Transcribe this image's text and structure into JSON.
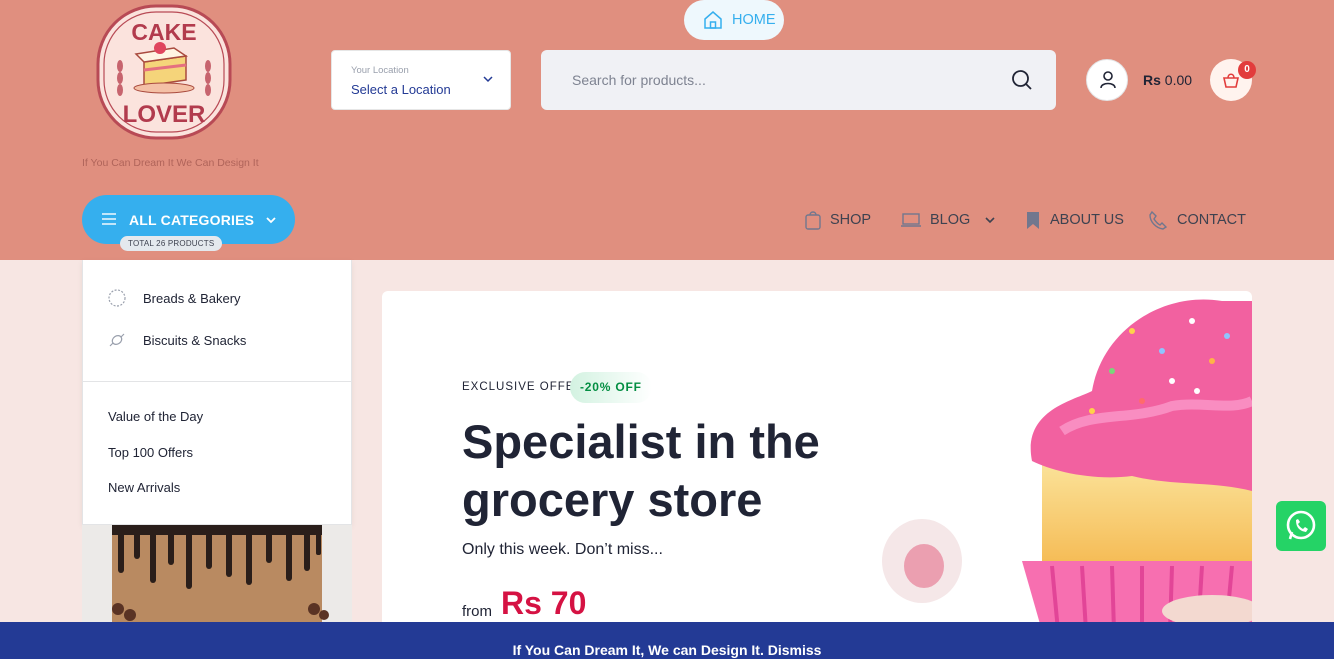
{
  "header": {
    "logo_text": [
      "CAKE",
      "LOVER"
    ],
    "tagline": "If You Can Dream It We Can Design It",
    "location": {
      "small_label": "Your Location",
      "value": "Select a Location"
    },
    "search": {
      "placeholder": "Search for products..."
    },
    "cart": {
      "currency": "Rs",
      "amount": "0.00",
      "count": "0"
    }
  },
  "categories_button": {
    "label": "ALL CATEGORIES",
    "count": "TOTAL 26 PRODUCTS"
  },
  "nav": {
    "items": [
      {
        "label": "HOME",
        "icon": "home-icon",
        "active": true
      },
      {
        "label": "SHOP",
        "icon": "shop-icon"
      },
      {
        "label": "BLOG",
        "icon": "laptop-icon",
        "has_dropdown": true
      },
      {
        "label": "ABOUT US",
        "icon": "bookmark-icon"
      },
      {
        "label": "CONTACT",
        "icon": "phone-icon"
      }
    ]
  },
  "dropdown": {
    "categories": [
      {
        "label": "Breads & Bakery",
        "icon": "bread-icon"
      },
      {
        "label": "Biscuits & Snacks",
        "icon": "candy-icon"
      }
    ],
    "links": [
      "Value of the Day",
      "Top 100 Offers",
      "New Arrivals"
    ]
  },
  "hero": {
    "offer_label": "EXCLUSIVE OFFER",
    "discount": "-20% OFF",
    "title": "Specialist in the grocery store",
    "subtitle": "Only this week. Don’t miss...",
    "from_label": "from",
    "price": "Rs 70"
  },
  "notice_bar": {
    "text": "If You Can Dream It, We can Design It. Dismiss"
  },
  "colors": {
    "header_bg": "#e08f7f",
    "accent": "#35afee",
    "price": "#d51243",
    "notice_bg": "#233a95",
    "whatsapp": "#25d366"
  }
}
